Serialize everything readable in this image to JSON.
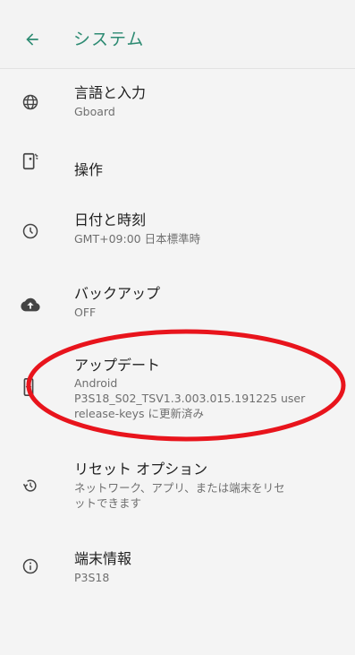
{
  "appbar": {
    "title": "システム",
    "back_icon": "arrow-back-icon",
    "accent_color": "#2e8b73"
  },
  "items": [
    {
      "title": "言語と入力",
      "sub": "Gboard",
      "icon": "globe-icon"
    },
    {
      "title": "操作",
      "icon": "gesture-phone-icon"
    },
    {
      "title": "日付と時刻",
      "sub": "GMT+09:00 日本標準時",
      "icon": "clock-icon"
    },
    {
      "title": "バックアップ",
      "sub": "OFF",
      "icon": "cloud-upload-icon"
    },
    {
      "title": "アップデート",
      "sub_lines": [
        "Android",
        "P3S18_S02_TSV1.3.003.015.191225 user",
        "release-keys に更新済み"
      ],
      "icon": "system-update-icon"
    },
    {
      "title": "リセット オプション",
      "sub_lines": [
        "ネットワーク、アプリ、または端末をリセ",
        "ットできます"
      ],
      "icon": "restore-icon"
    },
    {
      "title": "端末情報",
      "sub": "P3S18",
      "icon": "info-icon"
    }
  ],
  "annotation_color": "#e8141c"
}
